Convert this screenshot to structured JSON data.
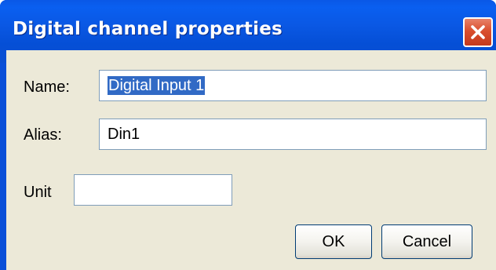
{
  "window": {
    "title": "Digital channel properties"
  },
  "form": {
    "name_label": "Name:",
    "name_value": "Digital Input 1",
    "alias_label": "Alias:",
    "alias_value": "Din1",
    "unit_label": "Unit",
    "unit_value": ""
  },
  "buttons": {
    "ok": "OK",
    "cancel": "Cancel"
  },
  "colors": {
    "titlebar": "#0a58e6",
    "client": "#ece9d8",
    "selection": "#316ac5",
    "close": "#d94f2e"
  },
  "icons": {
    "close": "close-icon"
  }
}
